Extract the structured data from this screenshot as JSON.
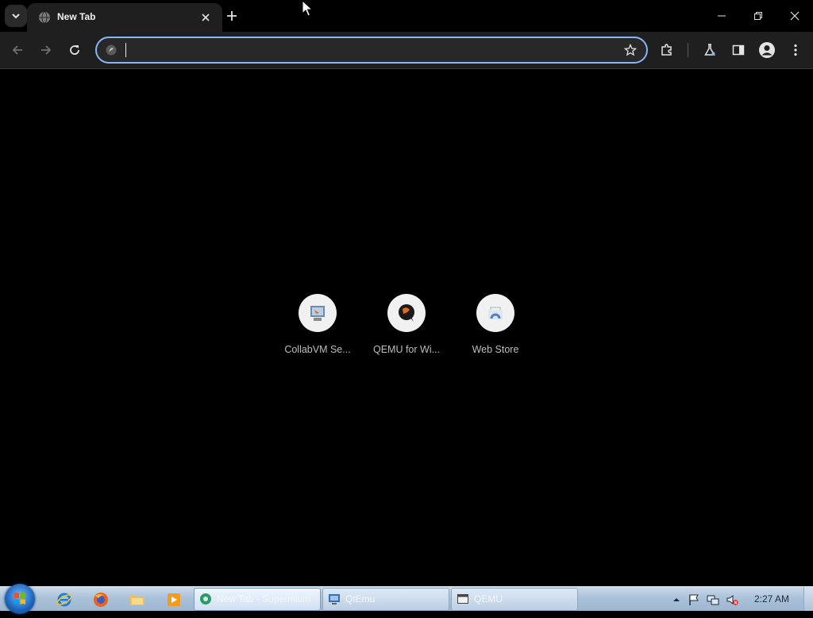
{
  "browser": {
    "tab": {
      "title": "New Tab"
    },
    "omnibox": {
      "value": "",
      "placeholder": ""
    }
  },
  "shortcuts": [
    {
      "label": "CollabVM Se...",
      "icon": "collabvm-icon"
    },
    {
      "label": "QEMU for Wi...",
      "icon": "qemu-icon"
    },
    {
      "label": "Web Store",
      "icon": "web-store-icon"
    }
  ],
  "taskbar": {
    "tasks": [
      {
        "label": "New Tab - Supermium",
        "icon": "supermium-icon"
      },
      {
        "label": "QtEmu",
        "icon": "qtemu-icon"
      },
      {
        "label": "QEMU",
        "icon": "qemu-window-icon"
      }
    ],
    "clock": "2:27 AM"
  },
  "colors": {
    "omnibox_focus": "#8ab4f8",
    "page_background": "#000000",
    "toolbar": "#1f1f1f"
  }
}
